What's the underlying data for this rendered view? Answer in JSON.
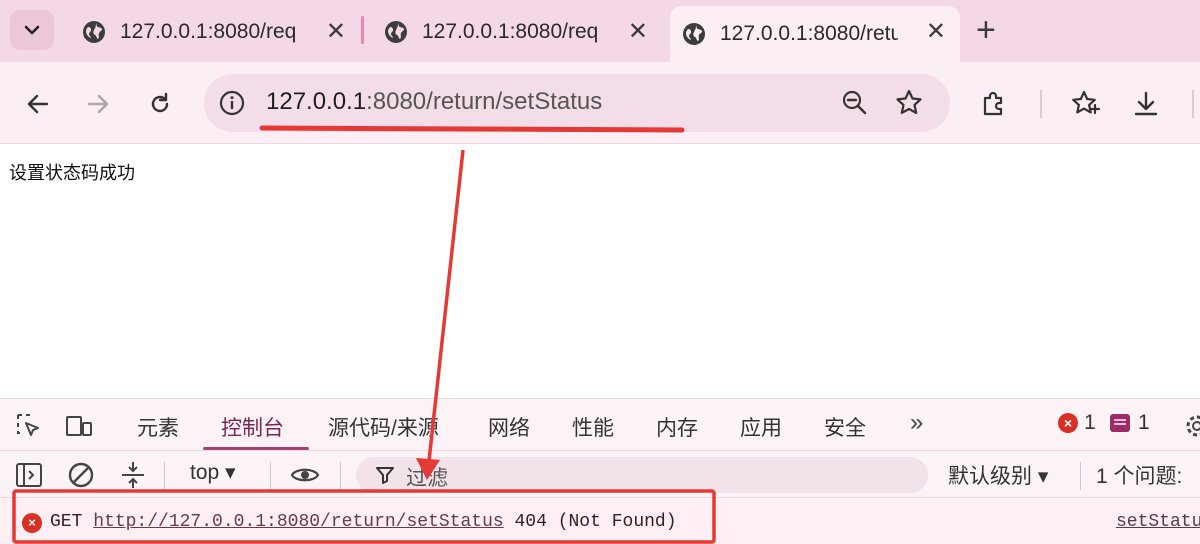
{
  "tabs": [
    {
      "title": "127.0.0.1:8080/req",
      "active": false
    },
    {
      "title": "127.0.0.1:8080/req",
      "active": false
    },
    {
      "title": "127.0.0.1:8080/retu",
      "active": true
    }
  ],
  "tab_close_glyph": "✕",
  "new_tab_glyph": "+",
  "omnibox": {
    "url_host": "127.0.0.1",
    "url_rest": ":8080/return/setStatus"
  },
  "page": {
    "text": "设置状态码成功"
  },
  "devtools": {
    "tabs": [
      "元素",
      "控制台",
      "源代码/来源",
      "网络",
      "性能",
      "内存",
      "应用",
      "安全"
    ],
    "active_tab": "控制台",
    "more_glyph": "»",
    "error_count": "1",
    "message_count": "1",
    "context": "top ▾",
    "filter_placeholder": "过滤",
    "levels": "默认级别 ▾",
    "issues": "1 个问题:",
    "console_row": {
      "method": "GET",
      "url": "http://127.0.0.1:8080/return/setStatus",
      "status": "404 (Not Found)",
      "source": "setStatu"
    }
  },
  "colors": {
    "tabstrip_bg": "#f5d8e6",
    "toolbar_bg": "#fbeef4",
    "annotation_red": "#e53935",
    "error_red": "#d93025"
  }
}
